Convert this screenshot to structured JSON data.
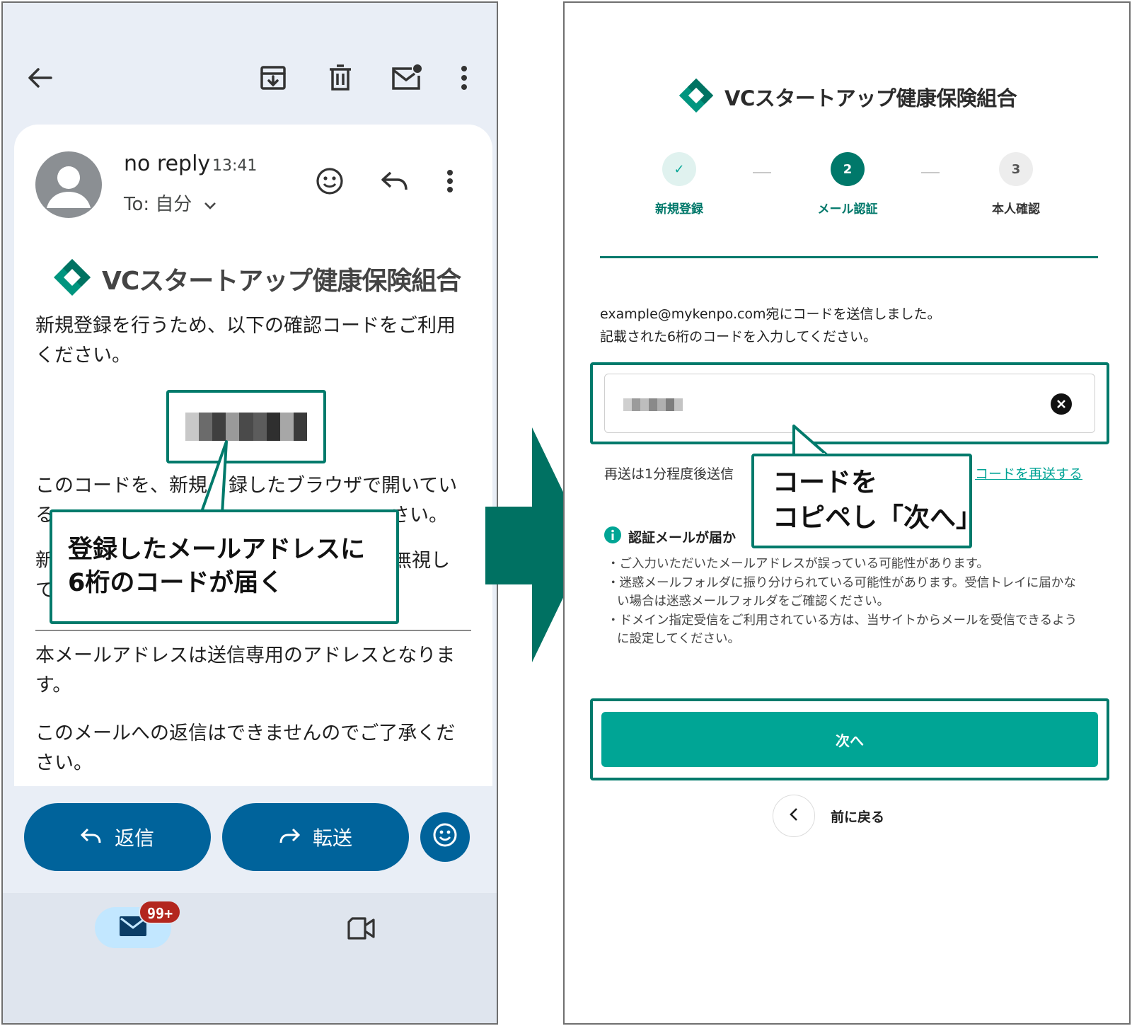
{
  "mail_app": {
    "sender_name": "no reply",
    "time": "13:41",
    "recipient": "To: 自分",
    "brand_name": "VCスタートアップ健康保険組合",
    "body_intro": "新規登録を行うため、以下の確認コードをご利用ください。",
    "body_browser_partial_line1": "このコードを、新規",
    "body_browser_partial_line1b": "録したブラウザで開いてい",
    "body_browser_partial_line2a": "る",
    "body_browser_partial_line2b": "さい。",
    "body_ignore_partial_a": "新",
    "body_ignore_partial_b": "無視し",
    "body_ignore_partial_c": "て",
    "body_sendonly": "本メールアドレスは送信専用のアドレスとなります。",
    "body_noreply": "このメールへの返信はできませんのでご了承ください。",
    "reply_button": "返信",
    "forward_button": "転送",
    "unread_badge": "99+"
  },
  "callouts": {
    "left_line1": "登録したメールアドレスに",
    "left_line2": "6桁のコードが届く",
    "right_line1": "コードを",
    "right_line2": "コピペし「次へ」"
  },
  "signup_form": {
    "brand_name": "VCスタートアップ健康保険組合",
    "steps": [
      {
        "number": "✓",
        "label": "新規登録",
        "state": "done"
      },
      {
        "number": "2",
        "label": "メール認証",
        "state": "active"
      },
      {
        "number": "3",
        "label": "本人確認",
        "state": "pending"
      }
    ],
    "sent_message": "example@mykenpo.com宛にコードを送信しました。",
    "instruction": "記載された6桁のコードを入力してください。",
    "resend_note": "再送は1分程度後送信",
    "resend_link": "コードを再送する",
    "info_title": "認証メールが届か",
    "tips": [
      "・ご入力いただいたメールアドレスが誤っている可能性があります。",
      "・迷惑メールフォルダに振り分けられている可能性があります。受信トレイに届かない場合は迷惑メールフォルダをご確認ください。",
      "・ドメイン指定受信をご利用されている方は、当サイトからメールを受信できるように設定してください。"
    ],
    "next_button": "次へ",
    "back_label": "前に戻る"
  },
  "colors": {
    "accent_teal": "#007a6b",
    "button_teal": "#00a595",
    "mail_blue": "#00639b",
    "badge_red": "#b3261e"
  }
}
